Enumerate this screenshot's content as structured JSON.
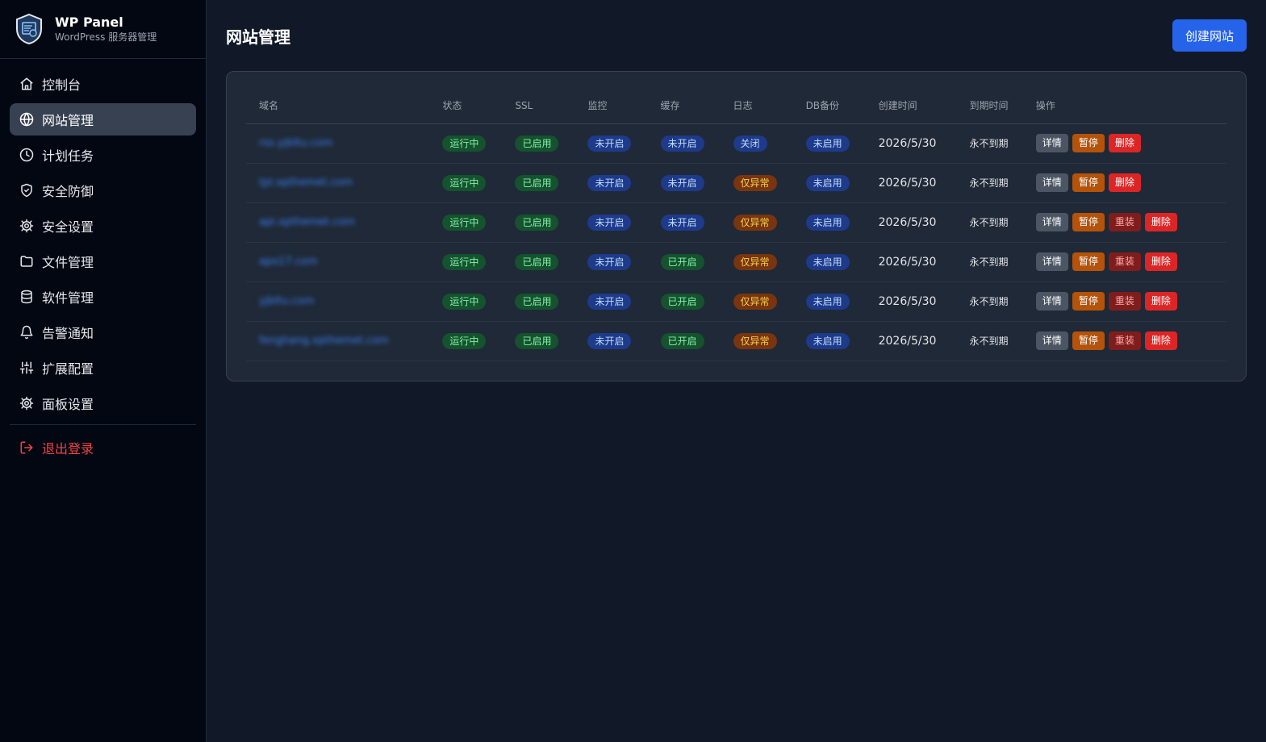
{
  "brand": {
    "title": "WP Panel",
    "subtitle": "WordPress 服务器管理"
  },
  "sidebar": {
    "items": [
      {
        "label": "控制台",
        "icon": "home-icon",
        "active": false
      },
      {
        "label": "网站管理",
        "icon": "globe-icon",
        "active": true
      },
      {
        "label": "计划任务",
        "icon": "clock-icon",
        "active": false
      },
      {
        "label": "安全防御",
        "icon": "shield-check-icon",
        "active": false
      },
      {
        "label": "安全设置",
        "icon": "gear-icon",
        "active": false
      },
      {
        "label": "文件管理",
        "icon": "folder-icon",
        "active": false
      },
      {
        "label": "软件管理",
        "icon": "database-icon",
        "active": false
      },
      {
        "label": "告警通知",
        "icon": "bell-icon",
        "active": false
      },
      {
        "label": "扩展配置",
        "icon": "sliders-icon",
        "active": false
      },
      {
        "label": "面板设置",
        "icon": "gear-icon",
        "active": false
      }
    ],
    "logout": {
      "label": "退出登录",
      "icon": "logout-icon"
    }
  },
  "header": {
    "title": "网站管理",
    "create_label": "创建网站"
  },
  "table": {
    "columns": [
      "域名",
      "状态",
      "SSL",
      "监控",
      "缓存",
      "日志",
      "DB备份",
      "创建时间",
      "到期时间",
      "操作"
    ],
    "rows": [
      {
        "domain": "rss.yjbltu.com",
        "status": "运行中",
        "ssl": "已启用",
        "monitor": "未开启",
        "cache": "未开启",
        "log": "关闭",
        "log_color": "blue",
        "db": "未启用",
        "created": "2026/5/30",
        "expire": "永不到期",
        "cache_color": "blue",
        "actions": [
          "详情",
          "暂停",
          "删除"
        ]
      },
      {
        "domain": "tpl.xpthemet.com",
        "status": "运行中",
        "ssl": "已启用",
        "monitor": "未开启",
        "cache": "未开启",
        "log": "仅异常",
        "log_color": "orange",
        "db": "未启用",
        "created": "2026/5/30",
        "expire": "永不到期",
        "cache_color": "blue",
        "actions": [
          "详情",
          "暂停",
          "删除"
        ]
      },
      {
        "domain": "api.xpthemet.com",
        "status": "运行中",
        "ssl": "已启用",
        "monitor": "未开启",
        "cache": "未开启",
        "log": "仅异常",
        "log_color": "orange",
        "db": "未启用",
        "created": "2026/5/30",
        "expire": "永不到期",
        "cache_color": "blue",
        "actions": [
          "详情",
          "暂停",
          "重装",
          "删除"
        ]
      },
      {
        "domain": "apo17.com",
        "status": "运行中",
        "ssl": "已启用",
        "monitor": "未开启",
        "cache": "已开启",
        "log": "仅异常",
        "log_color": "orange",
        "db": "未启用",
        "created": "2026/5/30",
        "expire": "永不到期",
        "cache_color": "green",
        "actions": [
          "详情",
          "暂停",
          "重装",
          "删除"
        ]
      },
      {
        "domain": "yjbltu.com",
        "status": "运行中",
        "ssl": "已启用",
        "monitor": "未开启",
        "cache": "已开启",
        "log": "仅异常",
        "log_color": "orange",
        "db": "未启用",
        "created": "2026/5/30",
        "expire": "永不到期",
        "cache_color": "green",
        "actions": [
          "详情",
          "暂停",
          "重装",
          "删除"
        ]
      },
      {
        "domain": "fenghang.xpthemet.com",
        "status": "运行中",
        "ssl": "已启用",
        "monitor": "未开启",
        "cache": "已开启",
        "log": "仅异常",
        "log_color": "orange",
        "db": "未启用",
        "created": "2026/5/30",
        "expire": "永不到期",
        "cache_color": "green",
        "actions": [
          "详情",
          "暂停",
          "重装",
          "删除"
        ]
      }
    ]
  },
  "colors": {
    "accent": "#2563eb",
    "sidebar_bg": "#030712",
    "main_bg": "#111827",
    "danger": "#dc2626"
  }
}
